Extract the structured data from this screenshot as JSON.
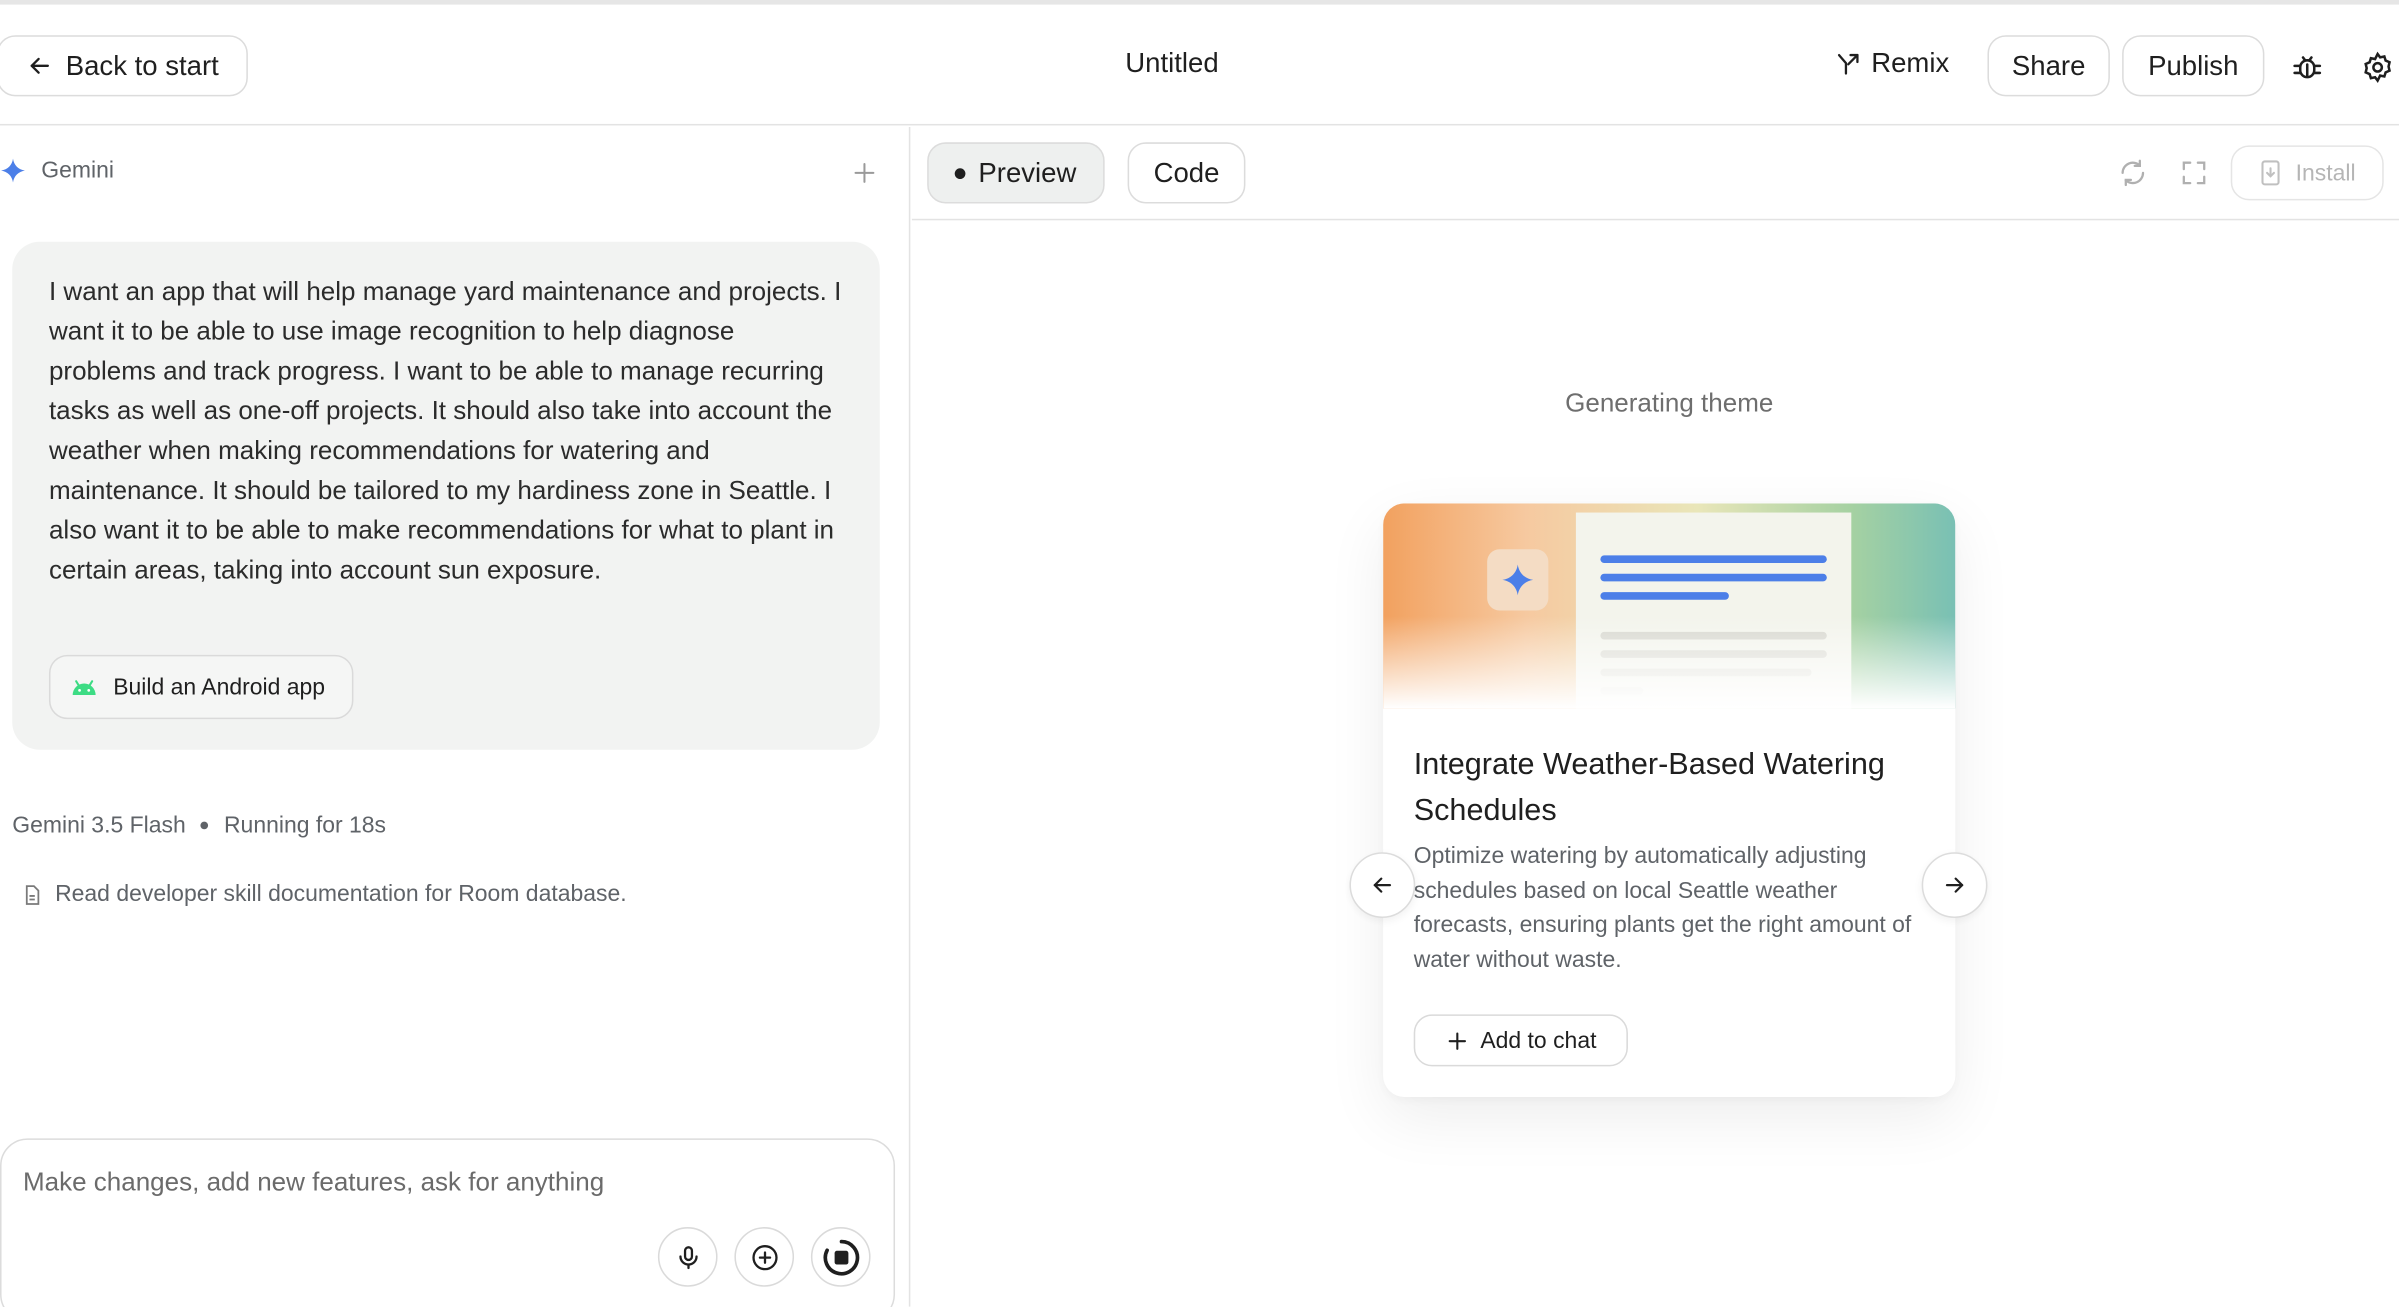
{
  "header": {
    "back_label": "Back to start",
    "title": "Untitled",
    "remix_label": "Remix",
    "share_label": "Share",
    "publish_label": "Publish"
  },
  "chat": {
    "model_name": "Gemini",
    "prompt": "I want an app that will help manage yard maintenance and projects. I want it to be able to use image recognition to help diagnose problems and track progress. I want to be able to manage recurring tasks as well as one-off projects. It should also take into account the weather when making recommendations for watering and maintenance. It should be tailored to my hardiness zone in Seattle. I also want it to be able to make recommendations for what to plant in certain areas, taking into account sun exposure.",
    "chip_label": "Build an Android app",
    "status_model": "Gemini 3.5 Flash",
    "status_running": "Running for 18s",
    "task_text": "Read developer skill documentation for Room database.",
    "composer_placeholder": "Make changes, add new features, ask for anything"
  },
  "preview": {
    "tab_preview": "Preview",
    "tab_code": "Code",
    "install_label": "Install",
    "generating_text": "Generating theme",
    "card": {
      "title": "Integrate Weather-Based Watering Schedules",
      "description": "Optimize watering by automatically adjusting schedules based on local Seattle weather forecasts, ensuring plants get the right amount of water without waste.",
      "add_label": "Add to chat"
    }
  },
  "colors": {
    "gemini_blue": "#4c7fe8",
    "android_green": "#3ddc84",
    "border": "#dcdcdc",
    "prompt_bg": "#f2f3f2"
  },
  "icons": [
    "arrow-left-icon",
    "remix-icon",
    "bug-icon",
    "gear-icon",
    "gemini-spark-icon",
    "plus-icon",
    "android-icon",
    "document-icon",
    "mic-icon",
    "add-circle-icon",
    "stop-icon",
    "refresh-icon",
    "fullscreen-icon",
    "install-icon",
    "arrow-right-icon"
  ]
}
